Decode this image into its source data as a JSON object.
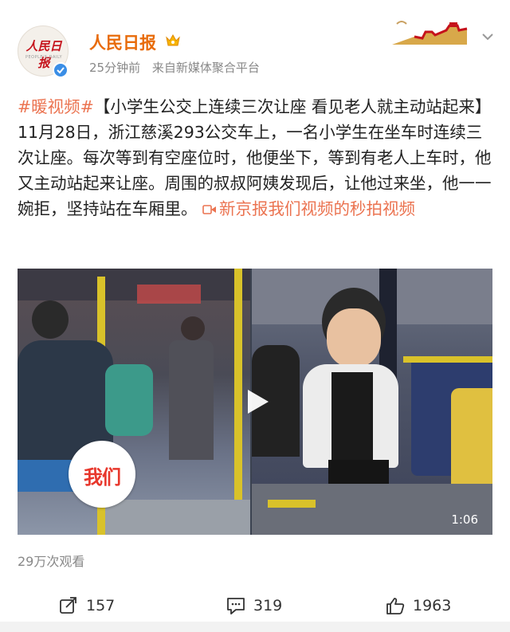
{
  "account": {
    "name": "人民日报",
    "logo_text": "人民日报",
    "logo_sub": "PEOPLE'S DAILY",
    "time": "25分钟前",
    "source": "来自新媒体聚合平台"
  },
  "post": {
    "hashtag": "#暖视频#",
    "body": "【小学生公交上连续三次让座 看见老人就主动站起来】11月28日，浙江慈溪293公交车上，一名小学生在坐车时连续三次让座。每次等到有空座位时，他便坐下，等到有老人上车时，他又主动站起来让座。周围的叔叔阿姨发现后，让他过来坐，他一一婉拒，坚持站在车厢里。",
    "video_link": "新京报我们视频的秒拍视频"
  },
  "video": {
    "watermark": "我们",
    "duration": "1:06"
  },
  "stats": {
    "views": "29万次观看",
    "reposts": "157",
    "comments": "319",
    "likes": "1963"
  },
  "colors": {
    "accent": "#eb7350",
    "name": "#e86b0a",
    "verified": "#3a8ee6"
  },
  "icons": [
    "verified-icon",
    "vip-badge-icon",
    "more-icon",
    "link-icon",
    "play-icon",
    "repost-icon",
    "comment-icon",
    "like-icon"
  ]
}
